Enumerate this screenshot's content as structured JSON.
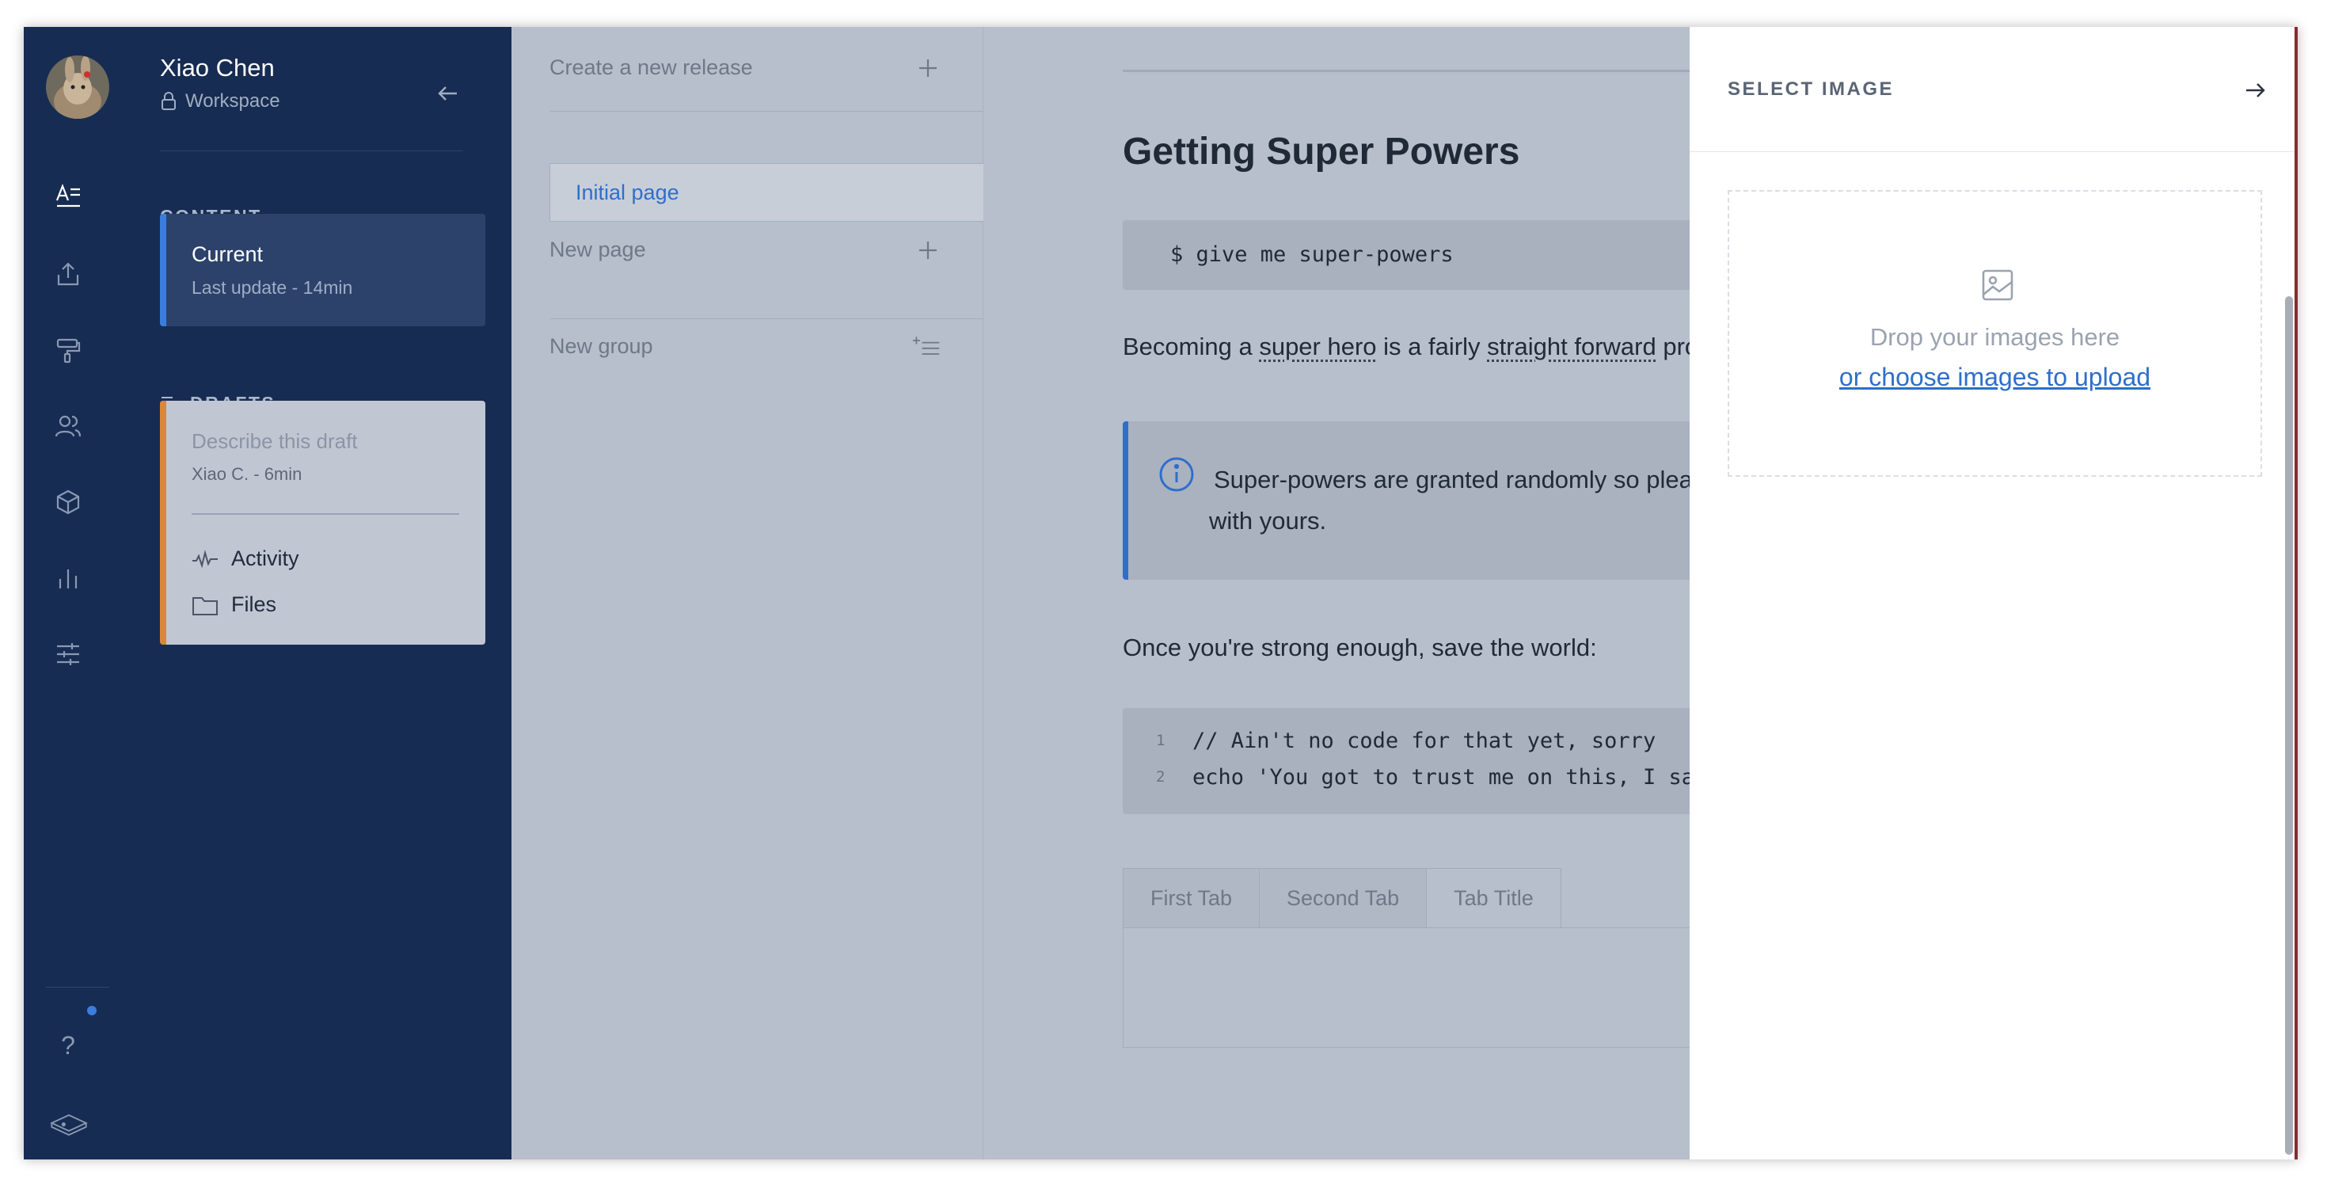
{
  "user": {
    "name": "Xiao Chen",
    "workspace": "Workspace"
  },
  "rail": {
    "icons": [
      "content-icon",
      "publish-icon",
      "paint-roller-icon",
      "users-icon",
      "cube-icon",
      "bar-chart-icon",
      "sliders-icon"
    ],
    "help": "?",
    "help_has_notification": true
  },
  "sidebar": {
    "content_label": "CONTENT",
    "current": {
      "title": "Current",
      "subtitle": "Last update - 14min"
    },
    "drafts_label": "DRAFTS",
    "draft": {
      "description": "Describe this draft",
      "meta": "Xiao C. - 6min",
      "items": [
        {
          "label": "Activity",
          "icon": "activity-icon"
        },
        {
          "label": "Files",
          "icon": "folder-icon"
        }
      ]
    }
  },
  "pages": {
    "create_release": "Create a new release",
    "initial_page": "Initial page",
    "new_page": "New page",
    "new_group": "New group"
  },
  "document": {
    "title": "Getting Super Powers",
    "command": "$ give me super-powers",
    "para1": {
      "a": "Becoming a ",
      "b": "super hero",
      "c": " is a fairly ",
      "d": "straight forward",
      "e": " pro"
    },
    "callout_line1": "Super-powers are granted randomly so pleas",
    "callout_line2": "with yours.",
    "para2": "Once you're strong enough, save the world:",
    "code": [
      {
        "n": "1",
        "text": "// Ain't no code for that yet, sorry"
      },
      {
        "n": "2",
        "text": "echo 'You got to trust me on this, I save"
      }
    ],
    "tabs": [
      "First Tab",
      "Second Tab",
      "Tab Title"
    ],
    "active_tab": "Tab Title"
  },
  "select_image": {
    "title": "SELECT IMAGE",
    "drop_text": "Drop your images here",
    "choose_link": "or choose images to upload"
  },
  "colors": {
    "navy": "#172c52",
    "accent": "#3b7ddd",
    "draft_accent": "#d58a36",
    "overlay_bg": "#b7bfcc"
  }
}
